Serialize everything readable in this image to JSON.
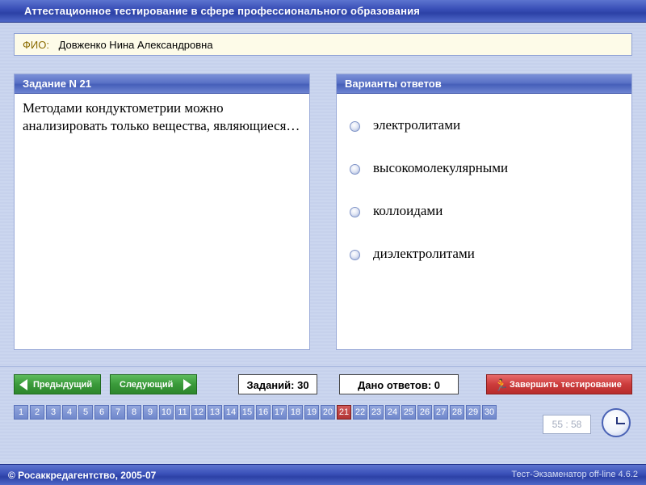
{
  "window": {
    "title": "Аттестационное тестирование в сфере профессионального образования"
  },
  "fio": {
    "label": "ФИО:",
    "value": "Довженко Нина Александровна"
  },
  "task": {
    "header": "Задание N 21",
    "question": "Методами кондуктометрии можно анализировать только вещества, являющиеся…"
  },
  "answers": {
    "header": "Варианты ответов",
    "options": [
      {
        "label": "электролитами",
        "selected": false
      },
      {
        "label": "высокомолекулярными",
        "selected": false
      },
      {
        "label": "коллоидами",
        "selected": false
      },
      {
        "label": "диэлектролитами",
        "selected": false
      }
    ]
  },
  "navigation": {
    "prev_label": "Предыдущий",
    "next_label": "Следующий",
    "tasks_count": "Заданий: 30",
    "answers_given": "Дано ответов: 0",
    "finish_label": "Завершить тестирование"
  },
  "pages": {
    "items": [
      "1",
      "2",
      "3",
      "4",
      "5",
      "6",
      "7",
      "8",
      "9",
      "10",
      "11",
      "12",
      "13",
      "14",
      "15",
      "16",
      "17",
      "18",
      "19",
      "20",
      "21",
      "22",
      "23",
      "24",
      "25",
      "26",
      "27",
      "28",
      "29",
      "30"
    ],
    "current": "21"
  },
  "timer": {
    "value": "55 : 58",
    "icon": "clock-icon"
  },
  "footer": {
    "copyright": "© Росаккредагентство, 2005-07",
    "version": "Тест-Экзаменатор off-line 4.6.2"
  },
  "colors": {
    "title_bar": "#3a50b8",
    "nav_green": "#3a9a3a",
    "finish_red": "#cc3c3c",
    "current_page": "#b23333"
  }
}
